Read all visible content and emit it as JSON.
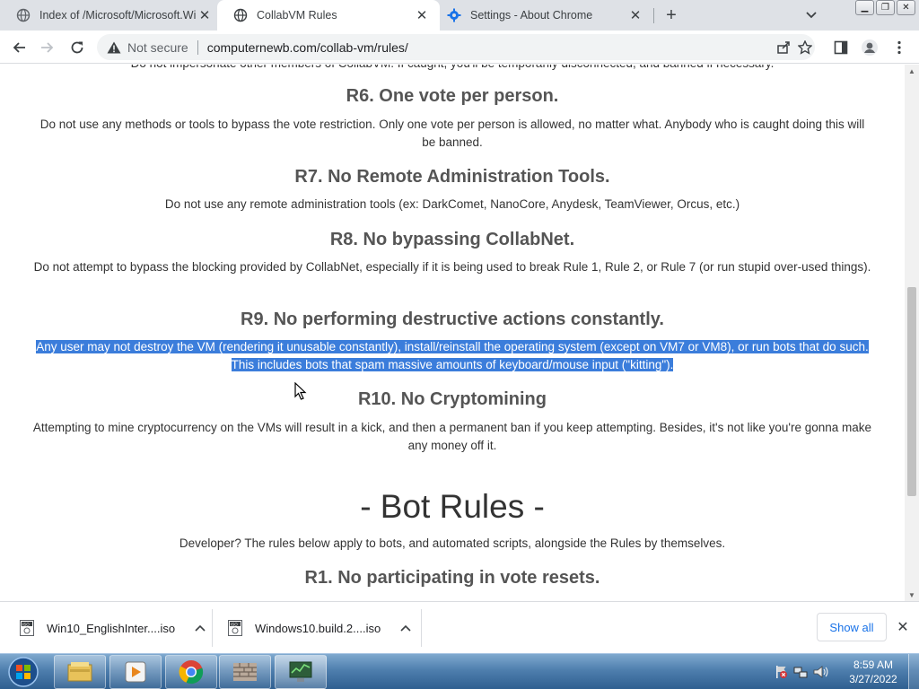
{
  "tabs": [
    {
      "title": "Index of /Microsoft/Microsoft.Wi",
      "active": false,
      "favicon": "globe-icon"
    },
    {
      "title": "CollabVM Rules",
      "active": true,
      "favicon": "globe-icon"
    },
    {
      "title": "Settings - About Chrome",
      "active": false,
      "favicon": "gear-icon"
    }
  ],
  "toolbar": {
    "security_label": "Not secure",
    "url": "computernewb.com/collab-vm/rules/"
  },
  "page": {
    "partial_line": "Do not impersonate other members of CollabVM. If caught, you'll be temporarily disconnected, and banned if necessary.",
    "rules": [
      {
        "heading": "R6. One vote per person.",
        "text": "Do not use any methods or tools to bypass the vote restriction. Only one vote per person is allowed, no matter what. Anybody who is caught doing this will be banned."
      },
      {
        "heading": "R7. No Remote Administration Tools.",
        "text": "Do not use any remote administration tools (ex: DarkComet, NanoCore, Anydesk, TeamViewer, Orcus, etc.)"
      },
      {
        "heading": "R8. No bypassing CollabNet.",
        "text": "Do not attempt to bypass the blocking provided by CollabNet, especially if it is being used to break Rule 1, Rule 2, or Rule 7 (or run stupid over-used things)."
      },
      {
        "heading": "R9. No performing destructive actions constantly.",
        "text": "Any user may not destroy the VM (rendering it unusable constantly), install/reinstall the operating system (except on VM7 or VM8), or run bots that do such. This includes bots that spam massive amounts of keyboard/mouse input (\"kitting\")."
      },
      {
        "heading": "R10. No Cryptomining",
        "text": "Attempting to mine cryptocurrency on the VMs will result in a kick, and then a permanent ban if you keep attempting. Besides, it's not like you're gonna make any money off it."
      }
    ],
    "bot_section": {
      "heading": "- Bot Rules -",
      "intro": "Developer? The rules below apply to bots, and automated scripts, alongside the Rules by themselves.",
      "first_rule": "R1. No participating in vote resets."
    }
  },
  "downloads": [
    {
      "name": "Win10_EnglishInter....iso"
    },
    {
      "name": "Windows10.build.2....iso"
    }
  ],
  "download_shelf": {
    "show_all": "Show all"
  },
  "taskbar": {
    "time": "8:59 AM",
    "date": "3/27/2022",
    "pinned": [
      "explorer-icon",
      "media-player-icon",
      "chrome-icon",
      "firewall-icon",
      "network-monitor-icon"
    ]
  },
  "colors": {
    "selection": "#3b7ddb",
    "heading": "#555555",
    "link_blue": "#1a73e8"
  }
}
